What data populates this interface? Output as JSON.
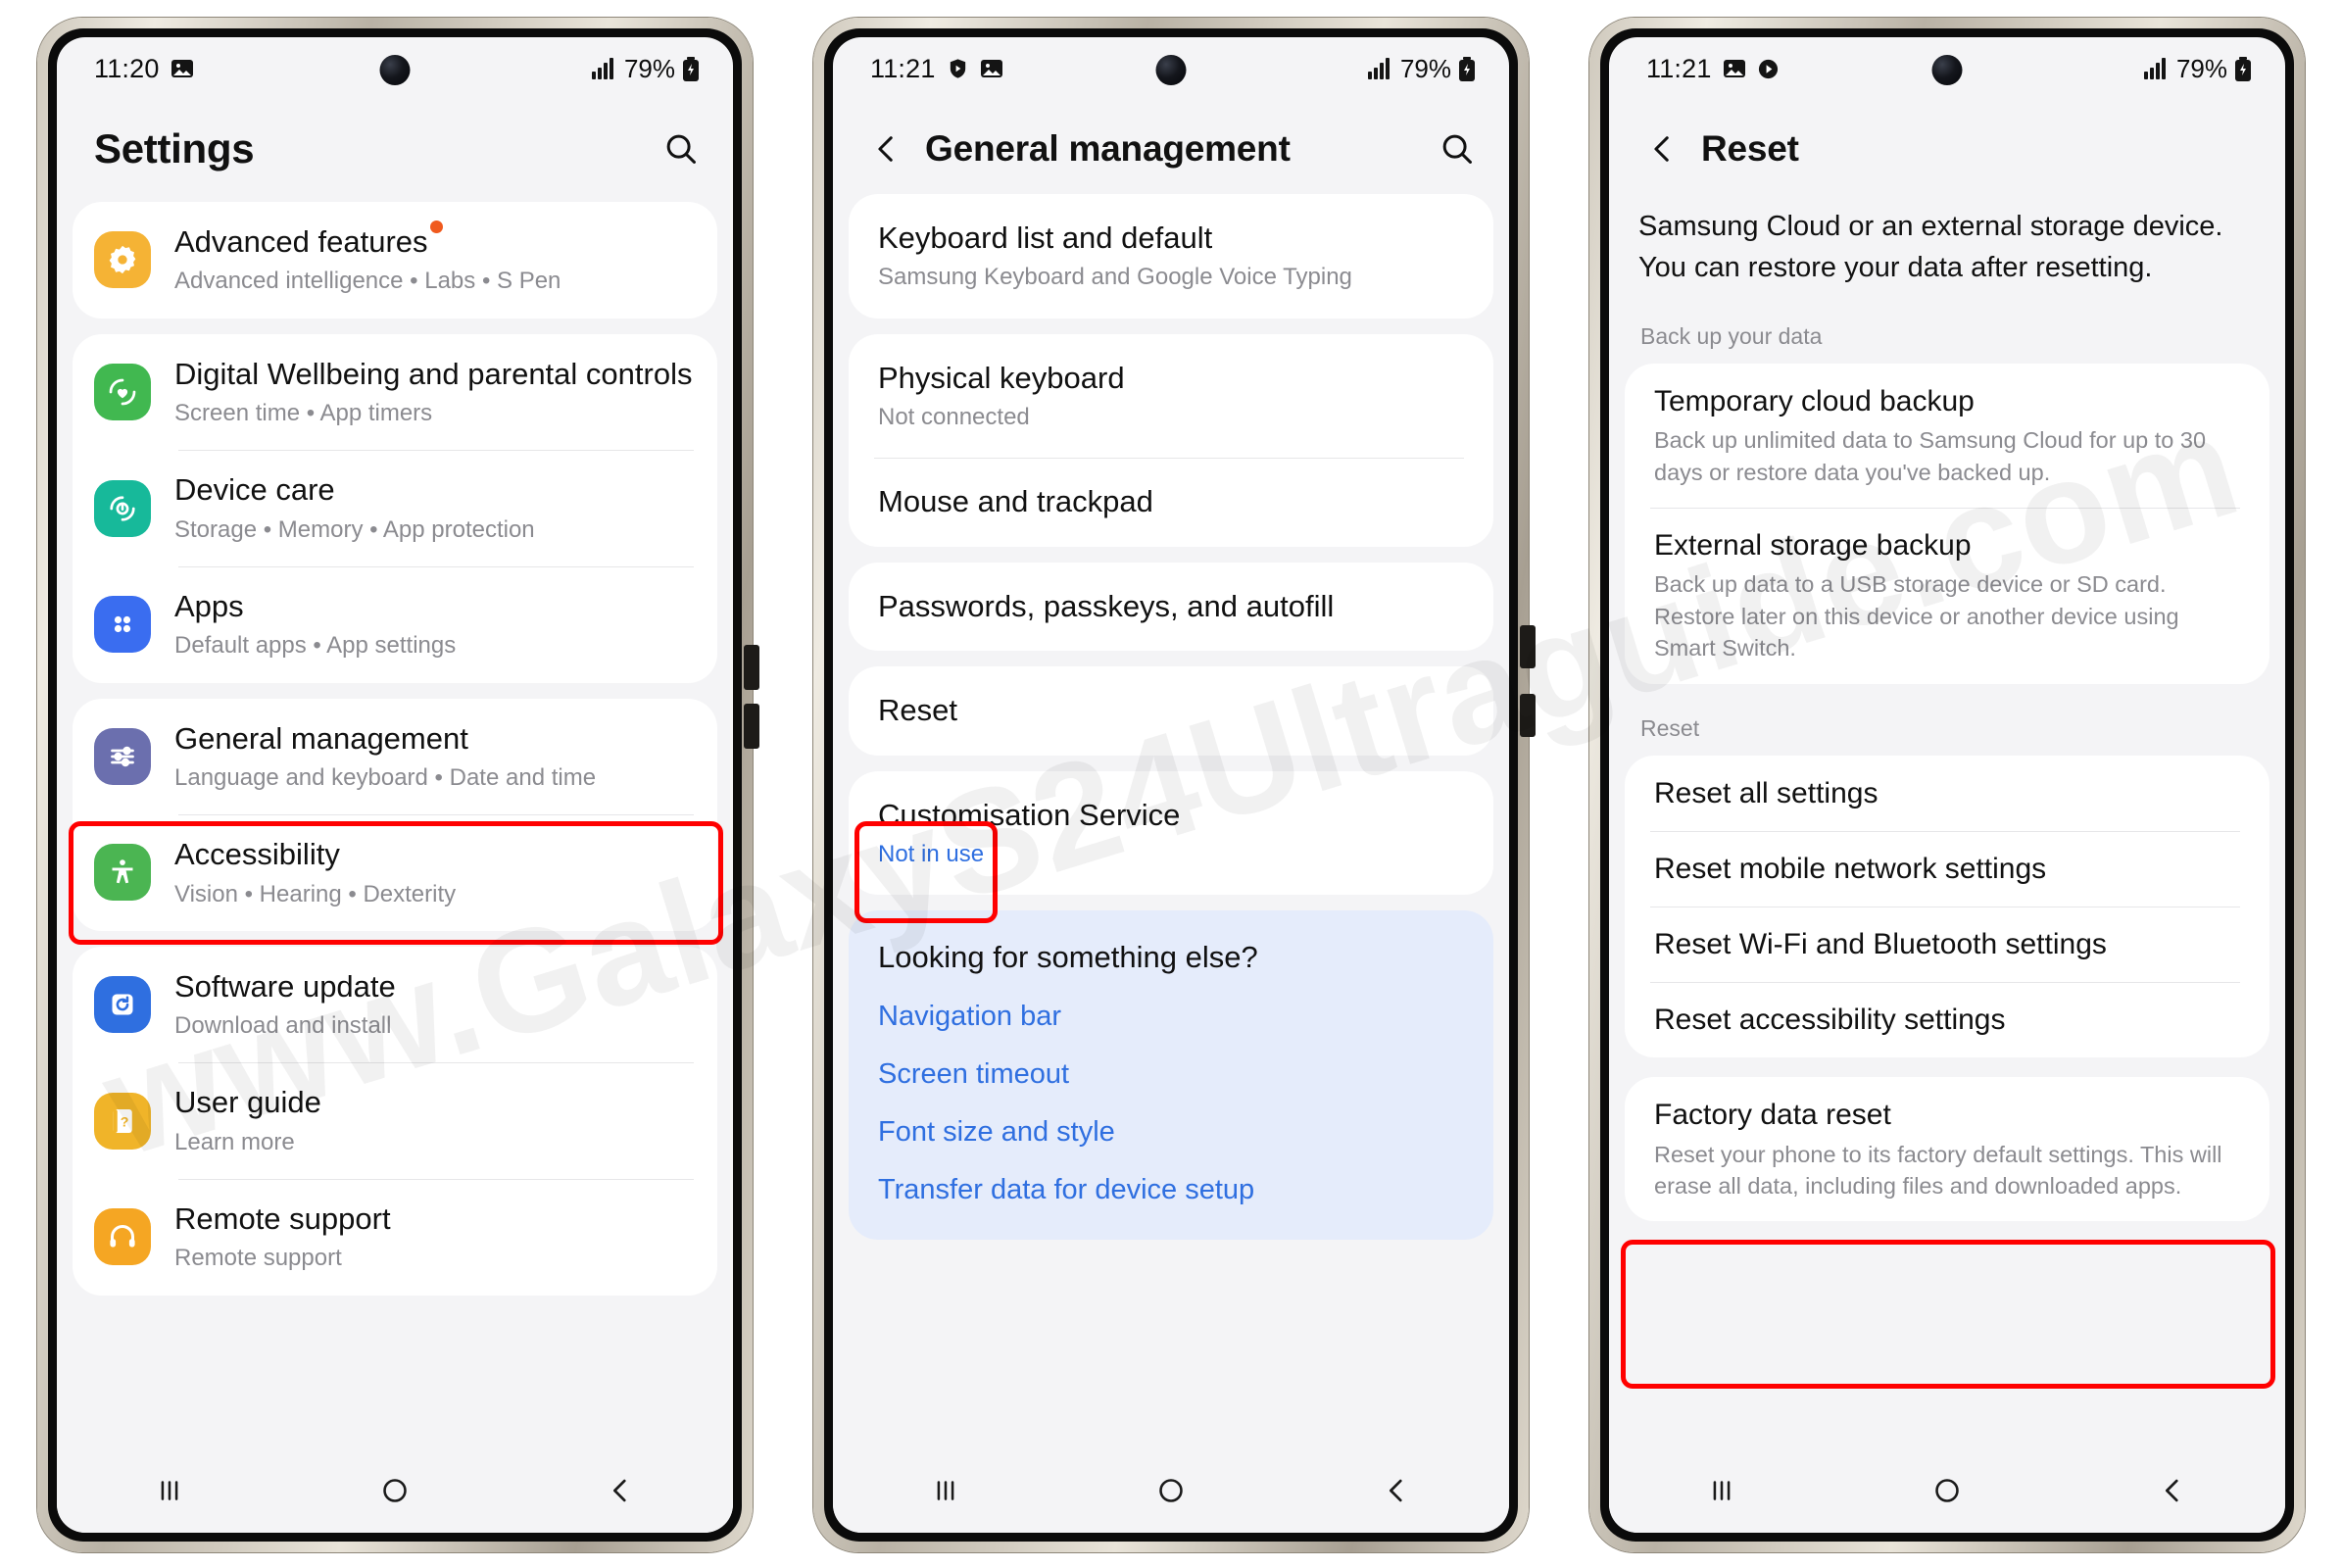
{
  "watermark": "www.GalaxyS24Ultraguide.com",
  "colors": {
    "highlight": "#ff0000",
    "link": "#2f6fe0",
    "badge": "#f05a1e",
    "blue_card_bg": "#e5ecfb"
  },
  "phones": [
    {
      "id": "settings",
      "status": {
        "time": "11:20",
        "left_icons": [
          "gallery-icon"
        ],
        "signal": "signal-bars-icon",
        "battery_percent": "79%",
        "battery_icon": "battery-charging-icon"
      },
      "header": {
        "title": "Settings",
        "search_icon": "search-icon",
        "has_back": false
      },
      "groups": [
        {
          "items": [
            {
              "icon": "advanced-features-icon",
              "icon_color": "#f5b335",
              "title": "Advanced features",
              "subtitle": "Advanced intelligence  •  Labs  •  S Pen",
              "badge": true
            }
          ]
        },
        {
          "items": [
            {
              "icon": "digital-wellbeing-icon",
              "icon_color": "#41b850",
              "title": "Digital Wellbeing and parental controls",
              "subtitle": "Screen time  •  App timers"
            },
            {
              "icon": "device-care-icon",
              "icon_color": "#17b99a",
              "title": "Device care",
              "subtitle": "Storage  •  Memory  •  App protection"
            },
            {
              "icon": "apps-icon",
              "icon_color": "#3a6df0",
              "title": "Apps",
              "subtitle": "Default apps  •  App settings"
            }
          ]
        },
        {
          "highlighted": true,
          "items": [
            {
              "icon": "general-management-icon",
              "icon_color": "#6b6fae",
              "title": "General management",
              "subtitle": "Language and keyboard  •  Date and time"
            },
            {
              "icon": "accessibility-icon",
              "icon_color": "#4bb552",
              "title": "Accessibility",
              "subtitle": "Vision  •  Hearing  •  Dexterity"
            }
          ]
        },
        {
          "items": [
            {
              "icon": "software-update-icon",
              "icon_color": "#2f6fe0",
              "title": "Software update",
              "subtitle": "Download and install"
            },
            {
              "icon": "user-guide-icon",
              "icon_color": "#f0b429",
              "title": "User guide",
              "subtitle": "Learn more"
            },
            {
              "icon": "remote-support-icon",
              "icon_color": "#f5a623",
              "title": "Remote support",
              "subtitle": "Remote support"
            }
          ]
        }
      ],
      "navbar": [
        "recents-icon",
        "home-icon",
        "back-icon"
      ]
    },
    {
      "id": "general-management",
      "status": {
        "time": "11:21",
        "left_icons": [
          "shield-play-icon",
          "gallery-icon"
        ],
        "signal": "signal-bars-icon",
        "battery_percent": "79%",
        "battery_icon": "battery-charging-icon"
      },
      "header": {
        "title": "General management",
        "search_icon": "search-icon",
        "has_back": true,
        "back_icon": "chevron-left-icon"
      },
      "groups": [
        {
          "items": [
            {
              "title": "Keyboard list and default",
              "subtitle": "Samsung Keyboard and Google Voice Typing"
            }
          ]
        },
        {
          "items": [
            {
              "title": "Physical keyboard",
              "subtitle": "Not connected"
            },
            {
              "title": "Mouse and trackpad"
            }
          ]
        },
        {
          "items": [
            {
              "title": "Passwords, passkeys, and autofill"
            }
          ]
        },
        {
          "highlighted": true,
          "items": [
            {
              "title": "Reset"
            }
          ]
        },
        {
          "items": [
            {
              "title": "Customisation Service",
              "subtitle": "Not in use",
              "subtitle_blue": true
            }
          ]
        }
      ],
      "looking_card": {
        "heading": "Looking for something else?",
        "links": [
          "Navigation bar",
          "Screen timeout",
          "Font size and style",
          "Transfer data for device setup"
        ]
      },
      "navbar": [
        "recents-icon",
        "home-icon",
        "back-icon"
      ]
    },
    {
      "id": "reset",
      "status": {
        "time": "11:21",
        "left_icons": [
          "gallery-icon",
          "play-icon"
        ],
        "signal": "signal-bars-icon",
        "battery_percent": "79%",
        "battery_icon": "battery-charging-icon"
      },
      "header": {
        "title": "Reset",
        "has_back": true,
        "back_icon": "chevron-left-icon",
        "search_icon": null
      },
      "intro": "Samsung Cloud or an external storage device. You can restore your data after resetting.",
      "sections": [
        {
          "label": "Back up your data",
          "items": [
            {
              "title": "Temporary cloud backup",
              "subtitle": "Back up unlimited data to Samsung Cloud for up to 30 days or restore data you've backed up."
            },
            {
              "title": "External storage backup",
              "subtitle": "Back up data to a USB storage device or SD card. Restore later on this device or another device using Smart Switch."
            }
          ]
        },
        {
          "label": "Reset",
          "items": [
            {
              "title": "Reset all settings"
            },
            {
              "title": "Reset mobile network settings"
            },
            {
              "title": "Reset Wi-Fi and Bluetooth settings"
            },
            {
              "title": "Reset accessibility settings"
            }
          ]
        },
        {
          "highlighted": true,
          "items": [
            {
              "title": "Factory data reset",
              "subtitle": "Reset your phone to its factory default settings. This will erase all data, including files and downloaded apps."
            }
          ]
        }
      ],
      "navbar": [
        "recents-icon",
        "home-icon",
        "back-icon"
      ]
    }
  ]
}
